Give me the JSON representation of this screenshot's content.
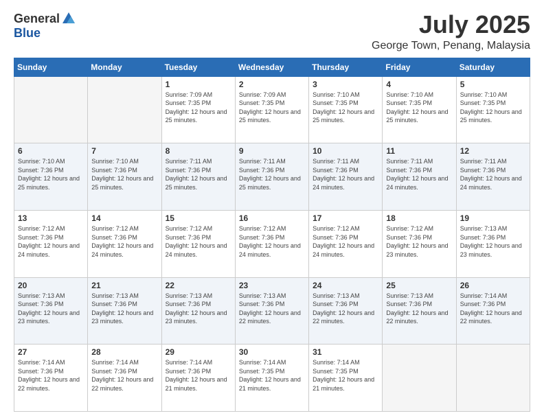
{
  "logo": {
    "general": "General",
    "blue": "Blue"
  },
  "header": {
    "month": "July 2025",
    "location": "George Town, Penang, Malaysia"
  },
  "weekdays": [
    "Sunday",
    "Monday",
    "Tuesday",
    "Wednesday",
    "Thursday",
    "Friday",
    "Saturday"
  ],
  "weeks": [
    [
      {
        "day": "",
        "info": ""
      },
      {
        "day": "",
        "info": ""
      },
      {
        "day": "1",
        "info": "Sunrise: 7:09 AM\nSunset: 7:35 PM\nDaylight: 12 hours and 25 minutes."
      },
      {
        "day": "2",
        "info": "Sunrise: 7:09 AM\nSunset: 7:35 PM\nDaylight: 12 hours and 25 minutes."
      },
      {
        "day": "3",
        "info": "Sunrise: 7:10 AM\nSunset: 7:35 PM\nDaylight: 12 hours and 25 minutes."
      },
      {
        "day": "4",
        "info": "Sunrise: 7:10 AM\nSunset: 7:35 PM\nDaylight: 12 hours and 25 minutes."
      },
      {
        "day": "5",
        "info": "Sunrise: 7:10 AM\nSunset: 7:35 PM\nDaylight: 12 hours and 25 minutes."
      }
    ],
    [
      {
        "day": "6",
        "info": "Sunrise: 7:10 AM\nSunset: 7:36 PM\nDaylight: 12 hours and 25 minutes."
      },
      {
        "day": "7",
        "info": "Sunrise: 7:10 AM\nSunset: 7:36 PM\nDaylight: 12 hours and 25 minutes."
      },
      {
        "day": "8",
        "info": "Sunrise: 7:11 AM\nSunset: 7:36 PM\nDaylight: 12 hours and 25 minutes."
      },
      {
        "day": "9",
        "info": "Sunrise: 7:11 AM\nSunset: 7:36 PM\nDaylight: 12 hours and 25 minutes."
      },
      {
        "day": "10",
        "info": "Sunrise: 7:11 AM\nSunset: 7:36 PM\nDaylight: 12 hours and 24 minutes."
      },
      {
        "day": "11",
        "info": "Sunrise: 7:11 AM\nSunset: 7:36 PM\nDaylight: 12 hours and 24 minutes."
      },
      {
        "day": "12",
        "info": "Sunrise: 7:11 AM\nSunset: 7:36 PM\nDaylight: 12 hours and 24 minutes."
      }
    ],
    [
      {
        "day": "13",
        "info": "Sunrise: 7:12 AM\nSunset: 7:36 PM\nDaylight: 12 hours and 24 minutes."
      },
      {
        "day": "14",
        "info": "Sunrise: 7:12 AM\nSunset: 7:36 PM\nDaylight: 12 hours and 24 minutes."
      },
      {
        "day": "15",
        "info": "Sunrise: 7:12 AM\nSunset: 7:36 PM\nDaylight: 12 hours and 24 minutes."
      },
      {
        "day": "16",
        "info": "Sunrise: 7:12 AM\nSunset: 7:36 PM\nDaylight: 12 hours and 24 minutes."
      },
      {
        "day": "17",
        "info": "Sunrise: 7:12 AM\nSunset: 7:36 PM\nDaylight: 12 hours and 24 minutes."
      },
      {
        "day": "18",
        "info": "Sunrise: 7:12 AM\nSunset: 7:36 PM\nDaylight: 12 hours and 23 minutes."
      },
      {
        "day": "19",
        "info": "Sunrise: 7:13 AM\nSunset: 7:36 PM\nDaylight: 12 hours and 23 minutes."
      }
    ],
    [
      {
        "day": "20",
        "info": "Sunrise: 7:13 AM\nSunset: 7:36 PM\nDaylight: 12 hours and 23 minutes."
      },
      {
        "day": "21",
        "info": "Sunrise: 7:13 AM\nSunset: 7:36 PM\nDaylight: 12 hours and 23 minutes."
      },
      {
        "day": "22",
        "info": "Sunrise: 7:13 AM\nSunset: 7:36 PM\nDaylight: 12 hours and 23 minutes."
      },
      {
        "day": "23",
        "info": "Sunrise: 7:13 AM\nSunset: 7:36 PM\nDaylight: 12 hours and 22 minutes."
      },
      {
        "day": "24",
        "info": "Sunrise: 7:13 AM\nSunset: 7:36 PM\nDaylight: 12 hours and 22 minutes."
      },
      {
        "day": "25",
        "info": "Sunrise: 7:13 AM\nSunset: 7:36 PM\nDaylight: 12 hours and 22 minutes."
      },
      {
        "day": "26",
        "info": "Sunrise: 7:14 AM\nSunset: 7:36 PM\nDaylight: 12 hours and 22 minutes."
      }
    ],
    [
      {
        "day": "27",
        "info": "Sunrise: 7:14 AM\nSunset: 7:36 PM\nDaylight: 12 hours and 22 minutes."
      },
      {
        "day": "28",
        "info": "Sunrise: 7:14 AM\nSunset: 7:36 PM\nDaylight: 12 hours and 22 minutes."
      },
      {
        "day": "29",
        "info": "Sunrise: 7:14 AM\nSunset: 7:36 PM\nDaylight: 12 hours and 21 minutes."
      },
      {
        "day": "30",
        "info": "Sunrise: 7:14 AM\nSunset: 7:35 PM\nDaylight: 12 hours and 21 minutes."
      },
      {
        "day": "31",
        "info": "Sunrise: 7:14 AM\nSunset: 7:35 PM\nDaylight: 12 hours and 21 minutes."
      },
      {
        "day": "",
        "info": ""
      },
      {
        "day": "",
        "info": ""
      }
    ]
  ]
}
